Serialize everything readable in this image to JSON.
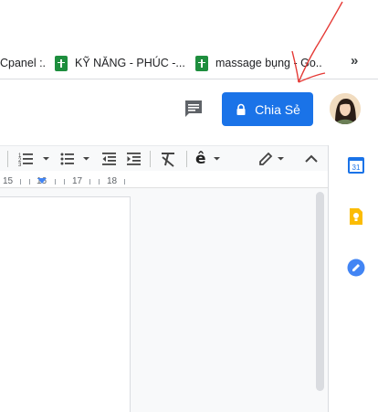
{
  "bookmarks": [
    {
      "label": "Cpanel :.",
      "icon": "none"
    },
    {
      "label": "KỸ NĂNG - PHÚC -...",
      "icon": "sheets-icon"
    },
    {
      "label": "massage bụng - Go...",
      "icon": "sheets-icon"
    }
  ],
  "bookmarks_more": "»",
  "header": {
    "share_label": "Chia Sẻ",
    "comment_icon": "comment-icon",
    "lock_icon": "lock-icon",
    "avatar": "user-avatar"
  },
  "toolbar": {
    "items": [
      "numbered-list-icon",
      "bulleted-list-icon",
      "decrease-indent-icon",
      "increase-indent-icon",
      "clear-formatting-icon",
      "input-tools-icon",
      "edit-mode-pencil-icon",
      "collapse-menu-icon"
    ],
    "input_tools_label": "ê"
  },
  "ruler": {
    "numbers": [
      "15",
      "16",
      "17",
      "18"
    ]
  },
  "side_panel": {
    "items": [
      "calendar-icon",
      "keep-icon",
      "tasks-icon"
    ],
    "calendar_label": "31"
  },
  "colors": {
    "accent": "#1a73e8",
    "sheets_green": "#1e8e3e",
    "keep_yellow": "#fbbc04",
    "annotation": "#e53935"
  }
}
